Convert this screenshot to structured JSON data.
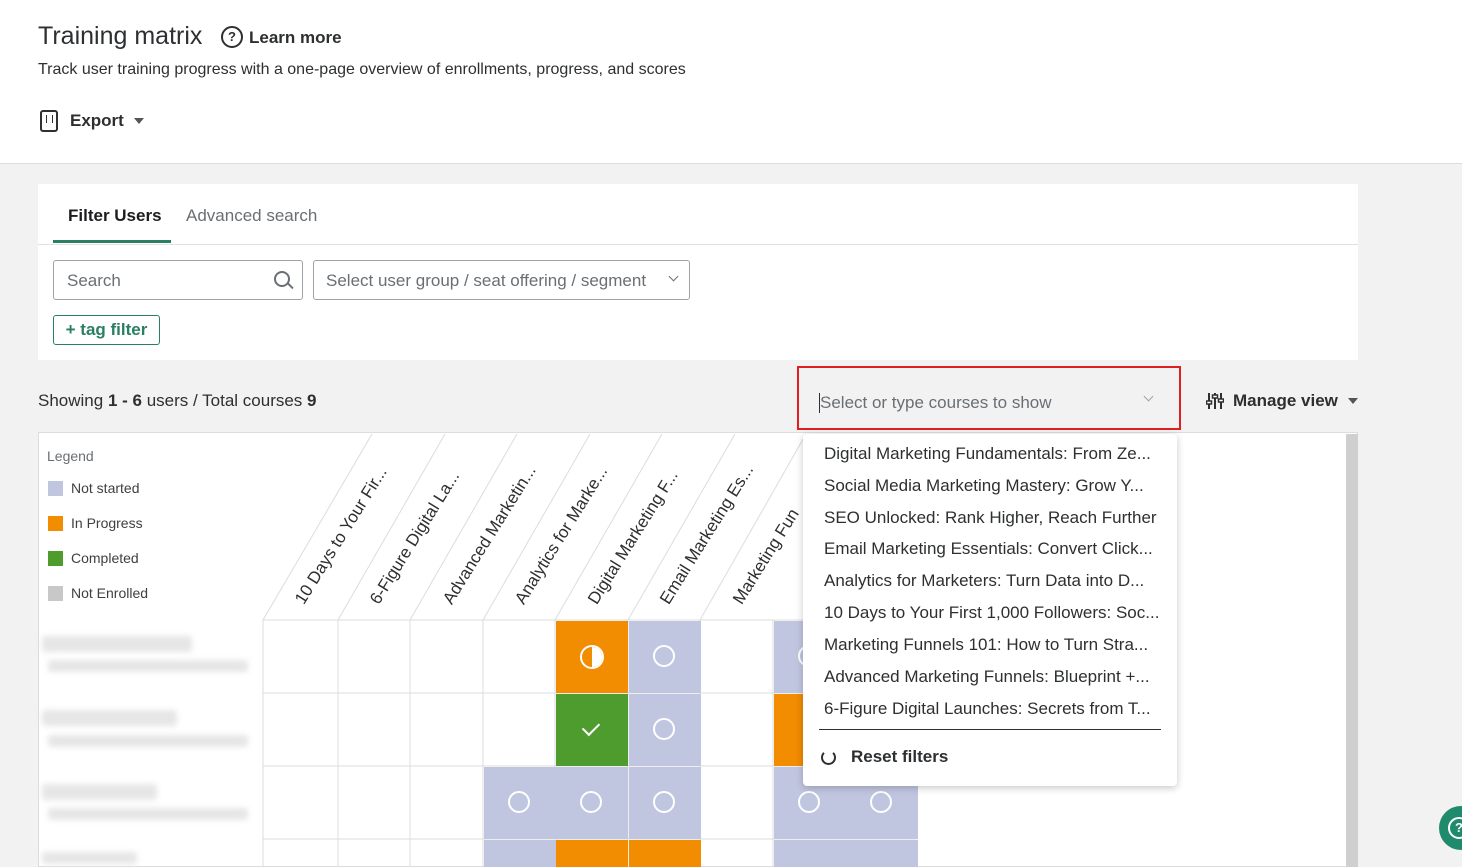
{
  "header": {
    "title": "Training matrix",
    "learn_more": "Learn more",
    "subtitle": "Track user training progress with a one-page overview of enrollments, progress, and scores",
    "export_label": "Export"
  },
  "filters": {
    "tabs": [
      {
        "label": "Filter Users",
        "active": true
      },
      {
        "label": "Advanced search",
        "active": false
      }
    ],
    "search_placeholder": "Search",
    "group_placeholder": "Select user group / seat offering / segment",
    "tag_filter_label": "+ tag filter"
  },
  "summary": {
    "prefix": "Showing",
    "range": "1 - 6",
    "users_label": "users / Total courses",
    "total_courses": "9"
  },
  "course_select": {
    "placeholder": "Select or type courses to show",
    "options": [
      "Digital Marketing Fundamentals: From Ze...",
      "Social Media Marketing Mastery: Grow Y...",
      "SEO Unlocked: Rank Higher, Reach Further",
      "Email Marketing Essentials: Convert Click...",
      "Analytics for Marketers: Turn Data into D...",
      "10 Days to Your First 1,000 Followers: Soc...",
      "Marketing Funnels 101: How to Turn Stra...",
      "Advanced Marketing Funnels: Blueprint +...",
      "6-Figure Digital Launches: Secrets from T..."
    ],
    "reset_label": "Reset filters"
  },
  "manage_view_label": "Manage view",
  "legend": {
    "title": "Legend",
    "items": [
      {
        "label": "Not started",
        "color": "#c1c6e0"
      },
      {
        "label": "In Progress",
        "color": "#f28c00"
      },
      {
        "label": "Completed",
        "color": "#4e9c2e"
      },
      {
        "label": "Not Enrolled",
        "color": "#c8c8c8"
      }
    ]
  },
  "matrix": {
    "columns": [
      "10 Days to Your Fir...",
      "6-Figure Digital La...",
      "Advanced Marketin...",
      "Analytics for Marke...",
      "Digital Marketing F...",
      "Email Marketing Es...",
      "Marketing Fun"
    ],
    "colors": {
      "not_started": "#c1c6e0",
      "in_progress": "#f28c00",
      "completed": "#4e9c2e"
    }
  }
}
